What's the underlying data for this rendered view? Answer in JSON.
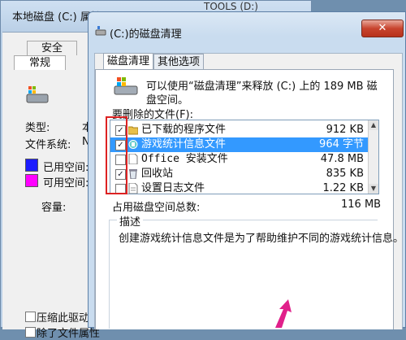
{
  "props_window": {
    "title": "本地磁盘 (C:) 属性",
    "tools_label": "TOOLS (D:)",
    "tab_security": "安全",
    "tab_general": "常规",
    "type_label": "类型:",
    "type_value": "本",
    "fs_label": "文件系统:",
    "fs_value": "N",
    "used_label": "已用空间:",
    "free_label": "可用空间:",
    "capacity_label": "容量:",
    "compress_label": "压缩此驱动",
    "index_label": "除了文件属性",
    "used_color": "#1c1cff",
    "free_color": "#ff00ff"
  },
  "dialog": {
    "title": "(C:)的磁盘清理",
    "close_glyph": "✕",
    "tabs": [
      "磁盘清理",
      "其他选项"
    ],
    "intro": "可以使用“磁盘清理”来释放 (C:) 上的 189 MB 磁",
    "intro_line2": "盘空间。",
    "files_label": "要删除的文件(F):",
    "files": [
      {
        "name": "已下载的程序文件",
        "size": "912 KB",
        "checked": true
      },
      {
        "name": "游戏统计信息文件",
        "size": "964 字节",
        "checked": true
      },
      {
        "name": "Office 安装文件",
        "size": "47.8 MB",
        "checked": false
      },
      {
        "name": "回收站",
        "size": "835 KB",
        "checked": true
      },
      {
        "name": "设置日志文件",
        "size": "1.22 KB",
        "checked": false
      }
    ],
    "total_label": "占用磁盘空间总数:",
    "total_value": "116 MB",
    "desc_title": "描述",
    "desc_text": "创建游戏统计信息文件是为了帮助维护不同的游戏统计信息。"
  },
  "colors": {
    "selection": "#3399ff",
    "highlight_border": "#dd2222",
    "arrow": "#e0208a"
  }
}
